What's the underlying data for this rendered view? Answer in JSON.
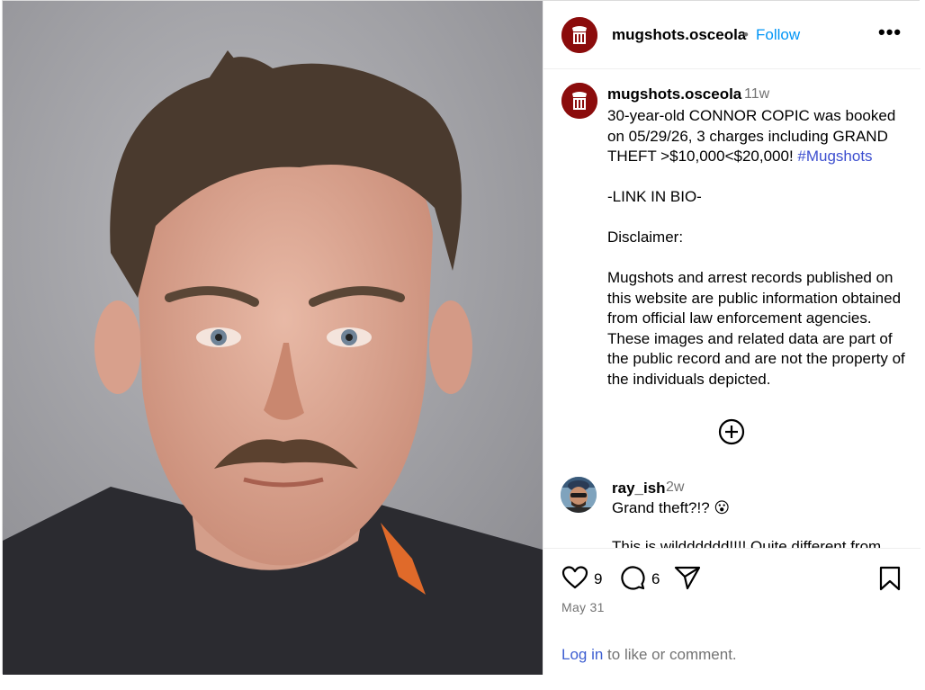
{
  "post": {
    "username": "mugshots.osceola",
    "follow_label": "Follow",
    "separator": "•",
    "more_label": "•••"
  },
  "caption": {
    "username": "mugshots.osceola",
    "time": "11w",
    "line1": "30-year-old CONNOR COPIC was booked on 05/29/26, 3 charges including GRAND THEFT >$10,000<$20,000! ",
    "hashtag": "#Mugshots",
    "link_line": "-LINK IN BIO-",
    "disclaimer_title": "Disclaimer:",
    "disclaimer_body": "Mugshots and arrest records published on this website are public information obtained from official law enforcement agencies. These images and related data are part of the public record and are not the property of the individuals depicted."
  },
  "comment": {
    "username": "ray_ish",
    "time": "2w",
    "text": "Grand theft?!? 😮",
    "next_text_partial": "This is wildddddd!!!! Quite different from"
  },
  "actions": {
    "likes": "9",
    "comments": "6",
    "date": "May 31",
    "login_link": "Log in",
    "login_rest": " to like or comment."
  },
  "colors": {
    "brand_red": "#8b0c0c",
    "link_blue": "#0095f6",
    "hashtag_blue": "#3d4fcf",
    "muted": "#737373"
  },
  "icons": [
    "heart-icon",
    "comment-icon",
    "share-icon",
    "bookmark-icon",
    "more-icon",
    "add-circle-icon"
  ]
}
